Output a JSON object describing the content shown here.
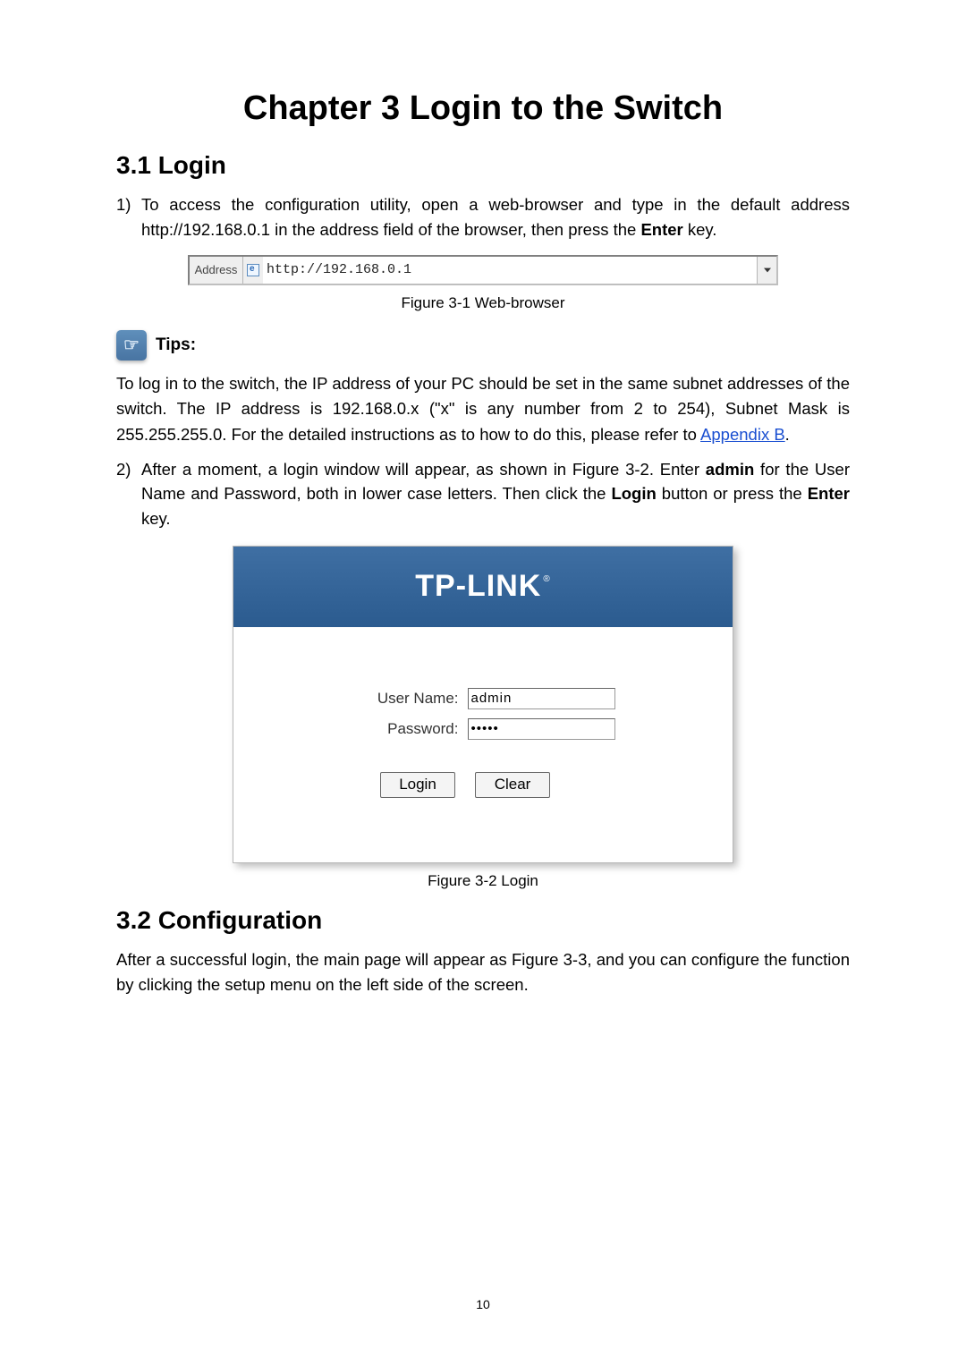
{
  "chapterTitle": "Chapter 3  Login to the Switch",
  "section1Title": "3.1  Login",
  "step1": {
    "num": "1)",
    "pre": "To access the configuration utility, open a web-browser and type in the default address http://192.168.0.1 in the address field of the browser, then press the ",
    "bold": "Enter",
    "post": " key."
  },
  "addressBar": {
    "label": "Address",
    "value": "http://192.168.0.1"
  },
  "figure1Caption": "Figure 3-1 Web-browser",
  "tipsLabel": "Tips:",
  "tipsIconGlyph": "☞",
  "tipsPara": {
    "pre": "To log in to the switch, the IP address of your PC should be set in the same subnet addresses of the switch. The IP address is 192.168.0.x (\"x\" is any number from 2 to 254), Subnet Mask is 255.255.255.0. For the detailed instructions as to how to do this, please refer to ",
    "link": "Appendix B",
    "post": "."
  },
  "step2": {
    "num": "2)",
    "t1": "After a moment, a login window will appear, as shown in Figure 3-2. Enter ",
    "b1": "admin",
    "t2": " for the User Name and Password, both in lower case letters. Then click the ",
    "b2": "Login",
    "t3": " button or press the ",
    "b3": "Enter",
    "t4": " key."
  },
  "loginBox": {
    "logo": "TP-LINK",
    "userNameLabel": "User Name:",
    "userNameValue": "admin",
    "passwordLabel": "Password:",
    "passwordValue": "•••••",
    "loginBtn": "Login",
    "clearBtn": "Clear"
  },
  "figure2Caption": "Figure 3-2 Login",
  "section2Title": "3.2  Configuration",
  "section2Para": "After a successful login, the main page will appear as Figure 3-3, and you can configure the function by clicking the setup menu on the left side of the screen.",
  "pageNumber": "10"
}
